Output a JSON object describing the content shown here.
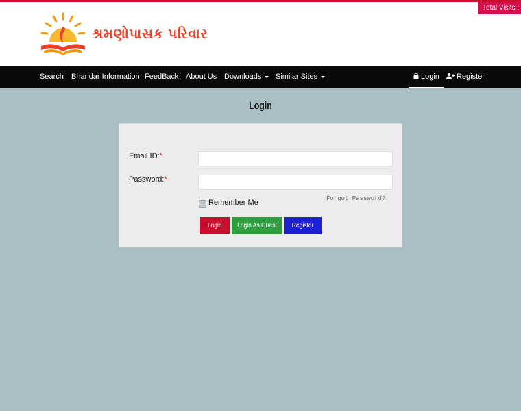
{
  "header": {
    "brand": "શ્રમણોપાસક પરિવાર",
    "total_visits_label": "Total Visits :"
  },
  "nav": {
    "items": [
      {
        "label": "Search",
        "has_dropdown": false
      },
      {
        "label": "Bhandar Information",
        "has_dropdown": false
      },
      {
        "label": "FeedBack",
        "has_dropdown": false
      },
      {
        "label": "About Us",
        "has_dropdown": false
      },
      {
        "label": "Downloads",
        "has_dropdown": true
      },
      {
        "label": "Similar Sites",
        "has_dropdown": true
      }
    ],
    "login": "Login",
    "register": "Register"
  },
  "page": {
    "title": "Login"
  },
  "form": {
    "email_label": "Email ID:",
    "password_label": "Password:",
    "required_mark": "*",
    "email_value": "",
    "password_value": "",
    "remember_label": "Remember Me",
    "remember_checked": false,
    "forgot_link": "Forgot Password?",
    "buttons": {
      "login": "Login",
      "guest": "Login As Guest",
      "register": "Register"
    }
  },
  "colors": {
    "accent_red": "#c8102e",
    "visits_bg": "#d40f4b",
    "login_btn": "#c8102e",
    "guest_btn": "#2f9e3f",
    "register_btn": "#1e20d6",
    "page_bg": "#a9bfc3",
    "brand_orange": "#e8432a"
  },
  "icons": {
    "login": "lock-icon",
    "register": "user-plus-icon",
    "logo": "sun-book-logo"
  }
}
